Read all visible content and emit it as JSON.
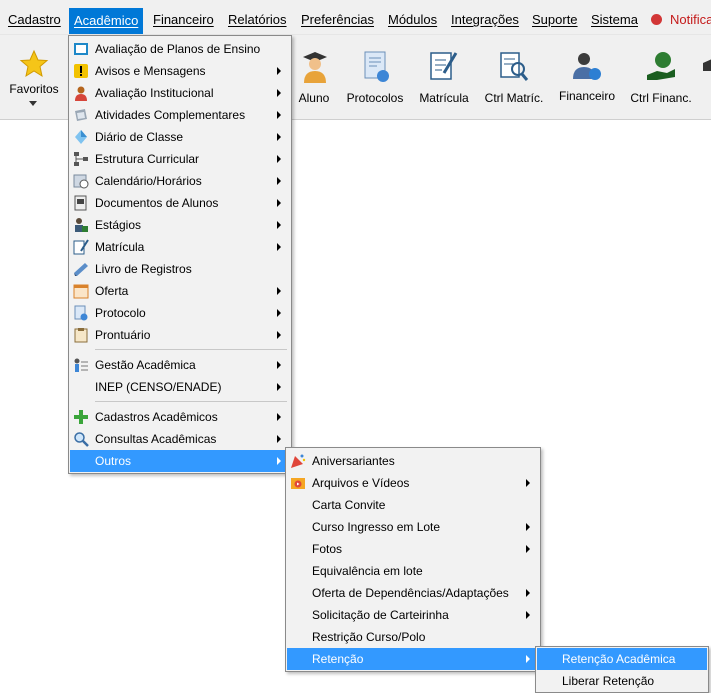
{
  "menubar": {
    "items": [
      {
        "label": "Cadastro"
      },
      {
        "label": "Acadêmico"
      },
      {
        "label": "Financeiro"
      },
      {
        "label": "Relatórios"
      },
      {
        "label": "Preferências"
      },
      {
        "label": "Módulos"
      },
      {
        "label": "Integrações"
      },
      {
        "label": "Suporte"
      },
      {
        "label": "Sistema"
      },
      {
        "label": "Notifica"
      }
    ]
  },
  "toolbar": {
    "items": [
      {
        "label": "Favoritos"
      },
      {
        "label": "Aluno"
      },
      {
        "label": "Protocolos"
      },
      {
        "label": "Matrícula"
      },
      {
        "label": "Ctrl Matríc."
      },
      {
        "label": "Financeiro"
      },
      {
        "label": "Ctrl Financ."
      }
    ]
  },
  "academico_menu": {
    "items": [
      {
        "label": "Avaliação de Planos de Ensino"
      },
      {
        "label": "Avisos e Mensagens"
      },
      {
        "label": "Avaliação Institucional"
      },
      {
        "label": "Atividades Complementares"
      },
      {
        "label": "Diário de Classe"
      },
      {
        "label": "Estrutura Curricular"
      },
      {
        "label": "Calendário/Horários"
      },
      {
        "label": "Documentos de Alunos"
      },
      {
        "label": "Estágios"
      },
      {
        "label": "Matrícula"
      },
      {
        "label": "Livro de Registros"
      },
      {
        "label": "Oferta"
      },
      {
        "label": "Protocolo"
      },
      {
        "label": "Prontuário"
      },
      {
        "label": "Gestão Acadêmica"
      },
      {
        "label": "INEP (CENSO/ENADE)"
      },
      {
        "label": "Cadastros Acadêmicos"
      },
      {
        "label": "Consultas Acadêmicas"
      },
      {
        "label": "Outros"
      }
    ]
  },
  "outros_menu": {
    "items": [
      {
        "label": "Aniversariantes"
      },
      {
        "label": "Arquivos e Vídeos"
      },
      {
        "label": "Carta Convite"
      },
      {
        "label": "Curso Ingresso em Lote"
      },
      {
        "label": "Fotos"
      },
      {
        "label": "Equivalência em lote"
      },
      {
        "label": "Oferta de Dependências/Adaptações"
      },
      {
        "label": "Solicitação de Carteirinha"
      },
      {
        "label": "Restrição Curso/Polo"
      },
      {
        "label": "Retenção"
      }
    ]
  },
  "retencao_menu": {
    "items": [
      {
        "label": "Retenção Acadêmica"
      },
      {
        "label": "Liberar Retenção"
      }
    ]
  },
  "colors": {
    "menu_highlight": "#3399ff",
    "menubar_active": "#0078d7"
  }
}
